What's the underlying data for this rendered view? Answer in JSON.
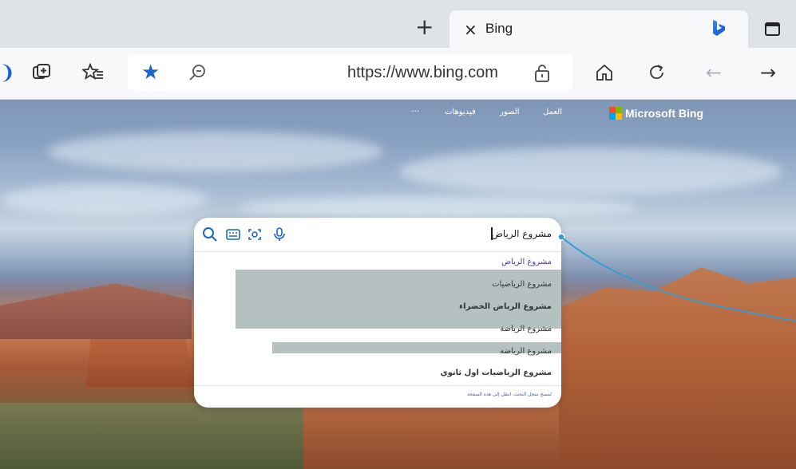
{
  "tab": {
    "title": "Bing",
    "close": "×",
    "new_tab": "+"
  },
  "address_bar": {
    "url": "https://www.bing.com"
  },
  "bing_nav": {
    "items": [
      "العمل",
      "الصور",
      "فيديوهات",
      "···"
    ],
    "logo_text": "Microsoft Bing"
  },
  "search": {
    "query": "مشروع الرياض",
    "suggestions": [
      "مشروع الرياض",
      "مشروع الرياضيات",
      "مشروع الرياض الخضراء",
      "مشروع الرياضة",
      "مشروع الرياضه",
      "مشروع الرياضيات اول ثانوي"
    ],
    "footer": "لمسح سجل البحث، انتقل إلى هذه الصفحة"
  },
  "colors": {
    "accent": "#1a66c9",
    "callout": "#2f9ed8"
  }
}
